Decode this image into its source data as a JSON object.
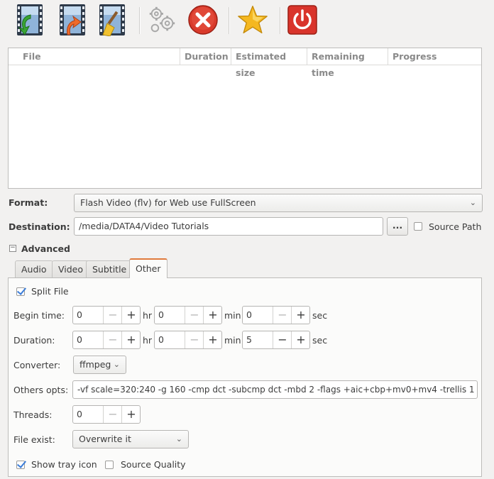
{
  "toolbar": {
    "icons": [
      "add-file-icon",
      "convert-icon",
      "clear-list-icon",
      "settings-gears-icon",
      "cancel-icon",
      "favorite-star-icon",
      "quit-power-icon"
    ]
  },
  "file_list": {
    "columns": [
      "File",
      "Duration",
      "Estimated size",
      "Remaining time",
      "Progress"
    ]
  },
  "format": {
    "label": "Format:",
    "value": "Flash Video (flv) for Web use FullScreen"
  },
  "destination": {
    "label": "Destination:",
    "value": "/media/DATA4/Video Tutorials",
    "browse_label": "...",
    "source_path_label": "Source Path"
  },
  "advanced": {
    "toggle": "−",
    "label": "Advanced"
  },
  "tabs": [
    "Audio",
    "Video",
    "Subtitle",
    "Other"
  ],
  "other": {
    "split_file_label": "Split File",
    "begin_time": {
      "label": "Begin time:",
      "hr": "0",
      "min": "0",
      "sec": "0",
      "hr_unit": "hr",
      "min_unit": "min",
      "sec_unit": "sec"
    },
    "duration": {
      "label": "Duration:",
      "hr": "0",
      "min": "0",
      "sec": "5",
      "hr_unit": "hr",
      "min_unit": "min",
      "sec_unit": "sec"
    },
    "converter": {
      "label": "Converter:",
      "value": "ffmpeg"
    },
    "others_opts": {
      "label": "Others opts:",
      "value": "-vf scale=320:240 -g 160 -cmp dct -subcmp dct -mbd 2 -flags +aic+cbp+mv0+mv4 -trellis 1"
    },
    "threads": {
      "label": "Threads:",
      "value": "0"
    },
    "file_exist": {
      "label": "File exist:",
      "value": "Overwrite it"
    },
    "show_tray_icon_label": "Show tray icon",
    "source_quality_label": "Source Quality"
  },
  "spin_glyphs": {
    "minus": "−",
    "plus": "+"
  },
  "colors": {
    "accent_tab": "#e07a3c",
    "check": "#3b7dd8",
    "cancel_red": "#d93a2b",
    "power_red": "#d9342b",
    "star": "#f5b820"
  }
}
